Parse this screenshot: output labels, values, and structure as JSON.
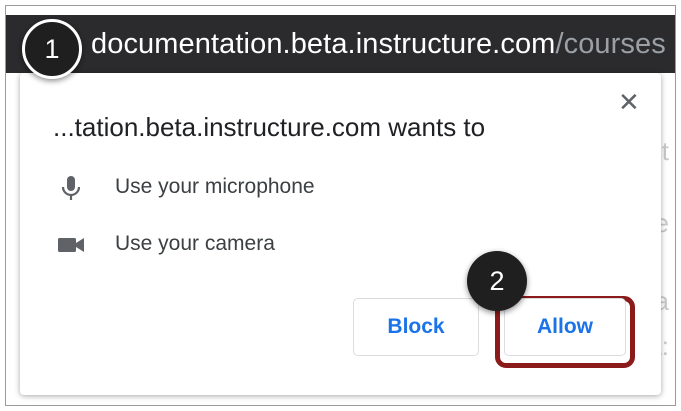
{
  "browser": {
    "url_host": "documentation.beta.instructure.com",
    "url_path": "/courses"
  },
  "dialog": {
    "title": "...tation.beta.instructure.com wants to",
    "close_symbol": "✕",
    "permissions": [
      {
        "icon": "microphone-icon",
        "label": "Use your microphone"
      },
      {
        "icon": "camera-icon",
        "label": "Use your camera"
      }
    ],
    "block_label": "Block",
    "allow_label": "Allow"
  },
  "steps": {
    "step1": "1",
    "step2": "2"
  },
  "colors": {
    "url_bar": "#2b2b2d",
    "button_text": "#1a73e8",
    "highlight": "#8b1a1a",
    "step_badge": "#1f1f1f"
  }
}
